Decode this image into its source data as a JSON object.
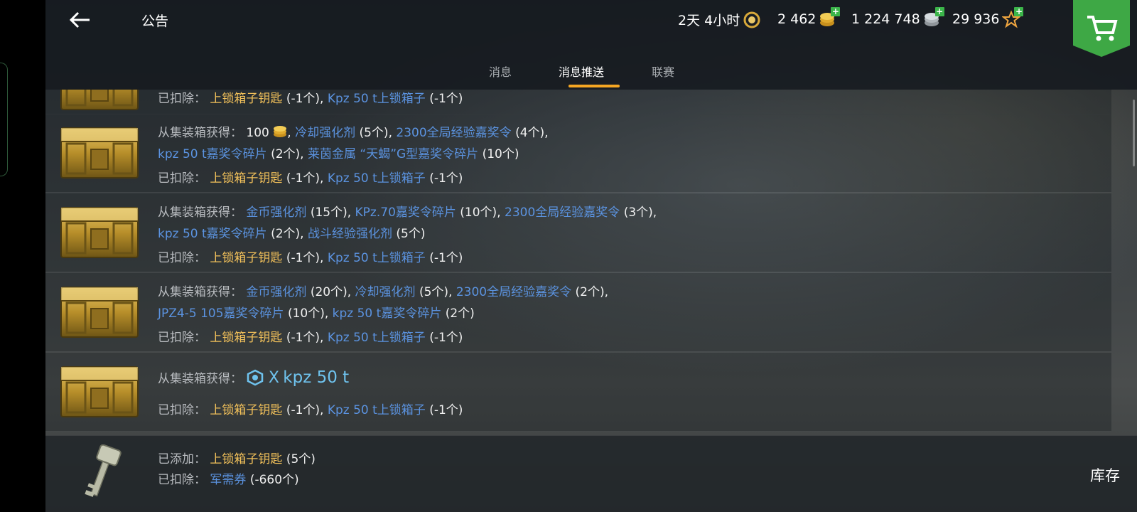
{
  "colors": {
    "gold": "#f1c05a",
    "blue": "#5b93e0",
    "accent_tab": "#f5a623",
    "shop_green": "#3ea845",
    "plus_green": "#3bb54a"
  },
  "header": {
    "back_icon": "back-arrow-icon",
    "title": "公告",
    "resources": {
      "premium_time": "2天 4小时",
      "gold": "2 462",
      "silver": "1 224 748",
      "free_xp": "29 936"
    },
    "shop_icon": "cart-icon"
  },
  "tabs": [
    {
      "label": "消息",
      "active": false
    },
    {
      "label": "消息推送",
      "active": true
    },
    {
      "label": "联赛",
      "active": false
    }
  ],
  "labels": {
    "obtained": "从集装箱获得：",
    "deducted": "已扣除：",
    "added": "已添加："
  },
  "rows": [
    {
      "deducted": [
        {
          "name": "上锁箱子钥匙",
          "count": "(-1个)"
        },
        {
          "name": "Kpz 50 t上锁箱子",
          "count": "(-1个)"
        }
      ]
    },
    {
      "obtained_line1": [
        {
          "name": "100",
          "count": ""
        },
        {
          "name": "冷却强化剂",
          "count": "(5个)"
        },
        {
          "name": "2300全局经验嘉奖令",
          "count": "(4个)"
        }
      ],
      "obtained_line2": [
        {
          "name": "kpz 50 t嘉奖令碎片",
          "count": "(2个)"
        },
        {
          "name": "莱茵金属 “天蝎”G型嘉奖令碎片",
          "count": "(10个)"
        }
      ],
      "deducted": [
        {
          "name": "上锁箱子钥匙",
          "count": "(-1个)"
        },
        {
          "name": "Kpz 50 t上锁箱子",
          "count": "(-1个)"
        }
      ]
    },
    {
      "obtained_line1": [
        {
          "name": "金币强化剂",
          "count": "(15个)"
        },
        {
          "name": "KPz.70嘉奖令碎片",
          "count": "(10个)"
        },
        {
          "name": "2300全局经验嘉奖令",
          "count": "(3个)"
        }
      ],
      "obtained_line2": [
        {
          "name": "kpz 50 t嘉奖令碎片",
          "count": "(2个)"
        },
        {
          "name": "战斗经验强化剂",
          "count": "(5个)"
        }
      ],
      "deducted": [
        {
          "name": "上锁箱子钥匙",
          "count": "(-1个)"
        },
        {
          "name": "Kpz 50 t上锁箱子",
          "count": "(-1个)"
        }
      ]
    },
    {
      "obtained_line1": [
        {
          "name": "金币强化剂",
          "count": "(20个)"
        },
        {
          "name": "冷却强化剂",
          "count": "(5个)"
        },
        {
          "name": "2300全局经验嘉奖令",
          "count": "(2个)"
        }
      ],
      "obtained_line2": [
        {
          "name": "JPZ4-5 105嘉奖令碎片",
          "count": "(10个)"
        },
        {
          "name": "kpz 50 t嘉奖令碎片",
          "count": "(2个)"
        }
      ],
      "deducted": [
        {
          "name": "上锁箱子钥匙",
          "count": "(-1个)"
        },
        {
          "name": "Kpz 50 t上锁箱子",
          "count": "(-1个)"
        }
      ]
    },
    {
      "tank_tier": "X",
      "tank_name": "kpz 50 t",
      "deducted": [
        {
          "name": "上锁箱子钥匙",
          "count": "(-1个)"
        },
        {
          "name": "Kpz 50 t上锁箱子",
          "count": "(-1个)"
        }
      ]
    }
  ],
  "bottom": {
    "added": [
      {
        "name": "上锁箱子钥匙",
        "count": "(5个)"
      }
    ],
    "deducted": [
      {
        "name": "军需券",
        "count": "(-660个)"
      }
    ],
    "inventory_button": "库存"
  },
  "icons": {
    "container": "container-icon",
    "key": "key-icon",
    "gold_coin": "gold-coins-icon",
    "silver_coin": "silver-coins-icon",
    "star": "star-icon",
    "premium": "premium-laurel-icon"
  }
}
